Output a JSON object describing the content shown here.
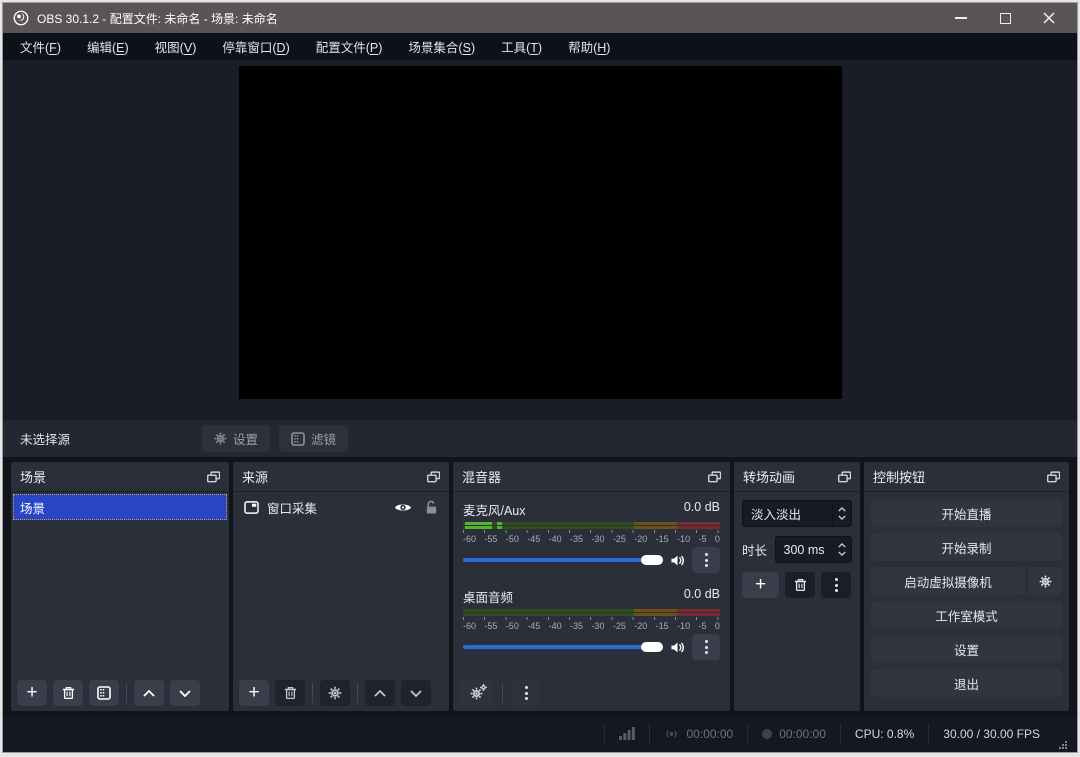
{
  "title_bar": {
    "title": "OBS 30.1.2 - 配置文件: 未命名 - 场景: 未命名"
  },
  "menu": {
    "items": [
      "文件(F)",
      "编辑(E)",
      "视图(V)",
      "停靠窗口(D)",
      "配置文件(P)",
      "场景集合(S)",
      "工具(T)",
      "帮助(H)"
    ]
  },
  "source_toolbar": {
    "status": "未选择源",
    "settings": "设置",
    "filters": "滤镜"
  },
  "scenes": {
    "title": "场景",
    "selected_item": "场景"
  },
  "sources": {
    "title": "来源",
    "item": "窗口采集"
  },
  "mixer": {
    "title": "混音器",
    "ticks": [
      "-60",
      "-55",
      "-50",
      "-45",
      "-40",
      "-35",
      "-30",
      "-25",
      "-20",
      "-15",
      "-10",
      "-5",
      "0"
    ],
    "channels": [
      {
        "name": "麦克风/Aux",
        "level": "0.0 dB"
      },
      {
        "name": "桌面音频",
        "level": "0.0 dB"
      }
    ]
  },
  "transitions": {
    "title": "转场动画",
    "current": "淡入淡出",
    "duration_label": "时长",
    "duration": "300 ms"
  },
  "controls": {
    "title": "控制按钮",
    "start_stream": "开始直播",
    "start_record": "开始录制",
    "virtual_cam": "启动虚拟摄像机",
    "studio_mode": "工作室模式",
    "settings": "设置",
    "exit": "退出"
  },
  "status_bar": {
    "stream_time": "00:00:00",
    "record_time": "00:00:00",
    "cpu": "CPU: 0.8%",
    "fps": "30.00 / 30.00 FPS"
  },
  "colors": {
    "titlebar": "#595455",
    "selection_blue": "#2a46c4",
    "slider_blue": "#2b6cd4",
    "meter_green_bright": "#54b32c",
    "meter_green_dim": "#2f4e1b",
    "meter_yellow_dim": "#6e5118",
    "meter_red_dim": "#7a2b31"
  }
}
